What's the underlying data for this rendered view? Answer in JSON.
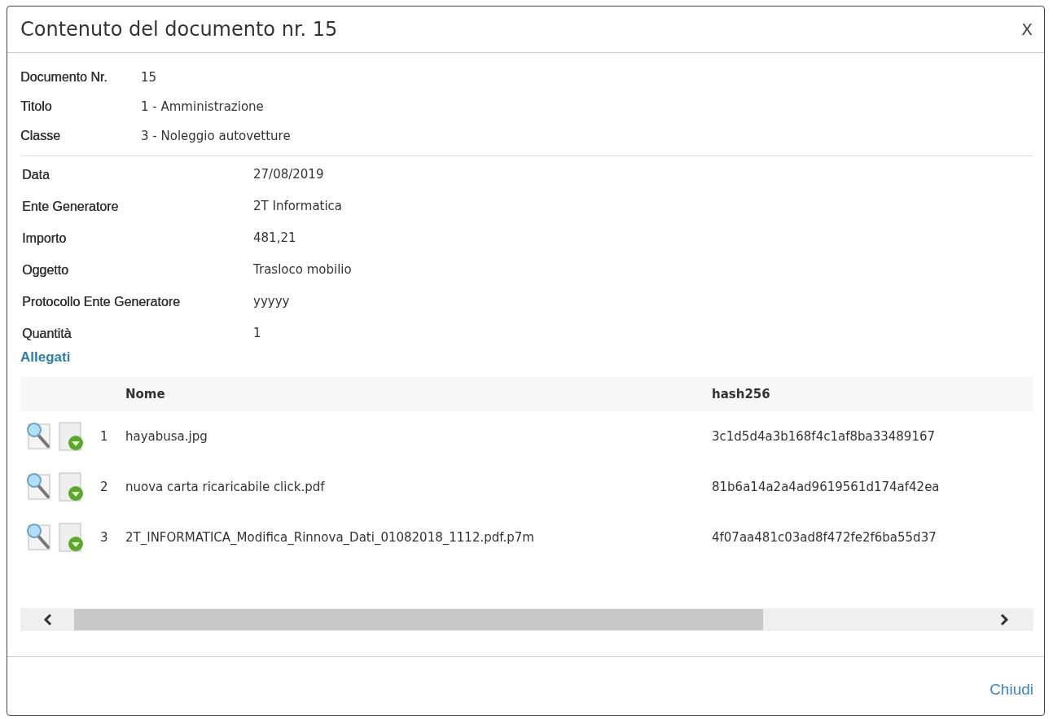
{
  "dialog": {
    "title": "Contenuto del documento nr. 15",
    "close": "X"
  },
  "header_fields": [
    {
      "label": "Documento Nr.",
      "value": "15"
    },
    {
      "label": "Titolo",
      "value": "1 - Amministrazione"
    },
    {
      "label": "Classe",
      "value": "3 - Noleggio autovetture"
    }
  ],
  "fields": [
    {
      "label": "Data",
      "value": "27/08/2019"
    },
    {
      "label": "Ente Generatore",
      "value": "2T Informatica"
    },
    {
      "label": "Importo",
      "value": "481,21"
    },
    {
      "label": "Oggetto",
      "value": "Trasloco mobilio"
    },
    {
      "label": "Protocollo Ente Generatore",
      "value": "yyyyy"
    },
    {
      "label": "Quantità",
      "value": "1"
    }
  ],
  "attachments": {
    "heading": "Allegati",
    "columns": [
      "Nome",
      "hash256"
    ],
    "rows": [
      {
        "number": "1",
        "name": "hayabusa.jpg",
        "hash": "3c1d5d4a3b168f4c1af8ba33489167"
      },
      {
        "number": "2",
        "name": "nuova carta ricaricabile click.pdf",
        "hash": "81b6a14a2a4ad9619561d174af42ea"
      },
      {
        "number": "3",
        "name": "2T_INFORMATICA_Modifica_Rinnova_Dati_01082018_1112.pdf.p7m",
        "hash": "4f07aa481c03ad8f472fe2f6ba55d37"
      }
    ]
  },
  "footer": {
    "button": "Chiudi"
  }
}
